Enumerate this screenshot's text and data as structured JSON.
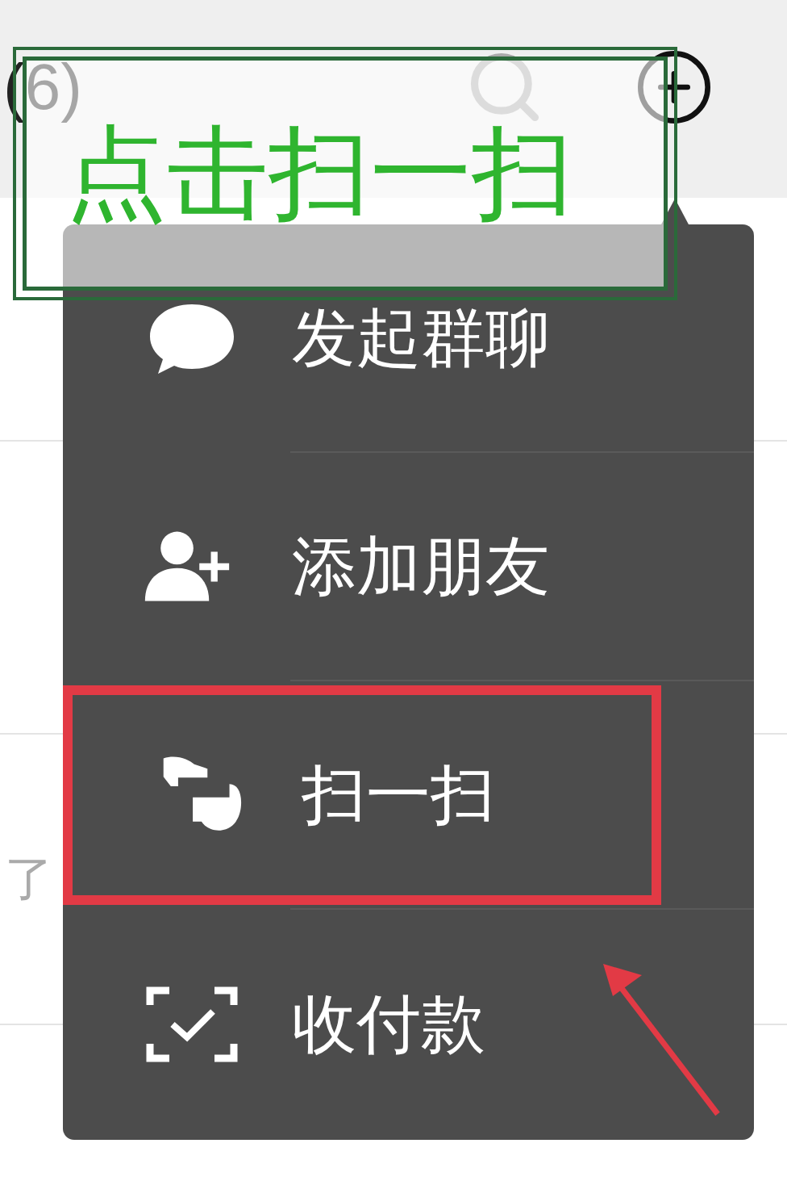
{
  "header": {
    "count": "(6)"
  },
  "annotation": {
    "label": "点击扫一扫"
  },
  "chat_rows": [
    {
      "preview": "了"
    }
  ],
  "menu": {
    "items": [
      {
        "kind": "chat",
        "label": "发起群聊",
        "highlighted": false
      },
      {
        "kind": "add-friend",
        "label": "添加朋友",
        "highlighted": false
      },
      {
        "kind": "scan",
        "label": "扫一扫",
        "highlighted": true
      },
      {
        "kind": "payment",
        "label": "收付款",
        "highlighted": false
      }
    ]
  }
}
